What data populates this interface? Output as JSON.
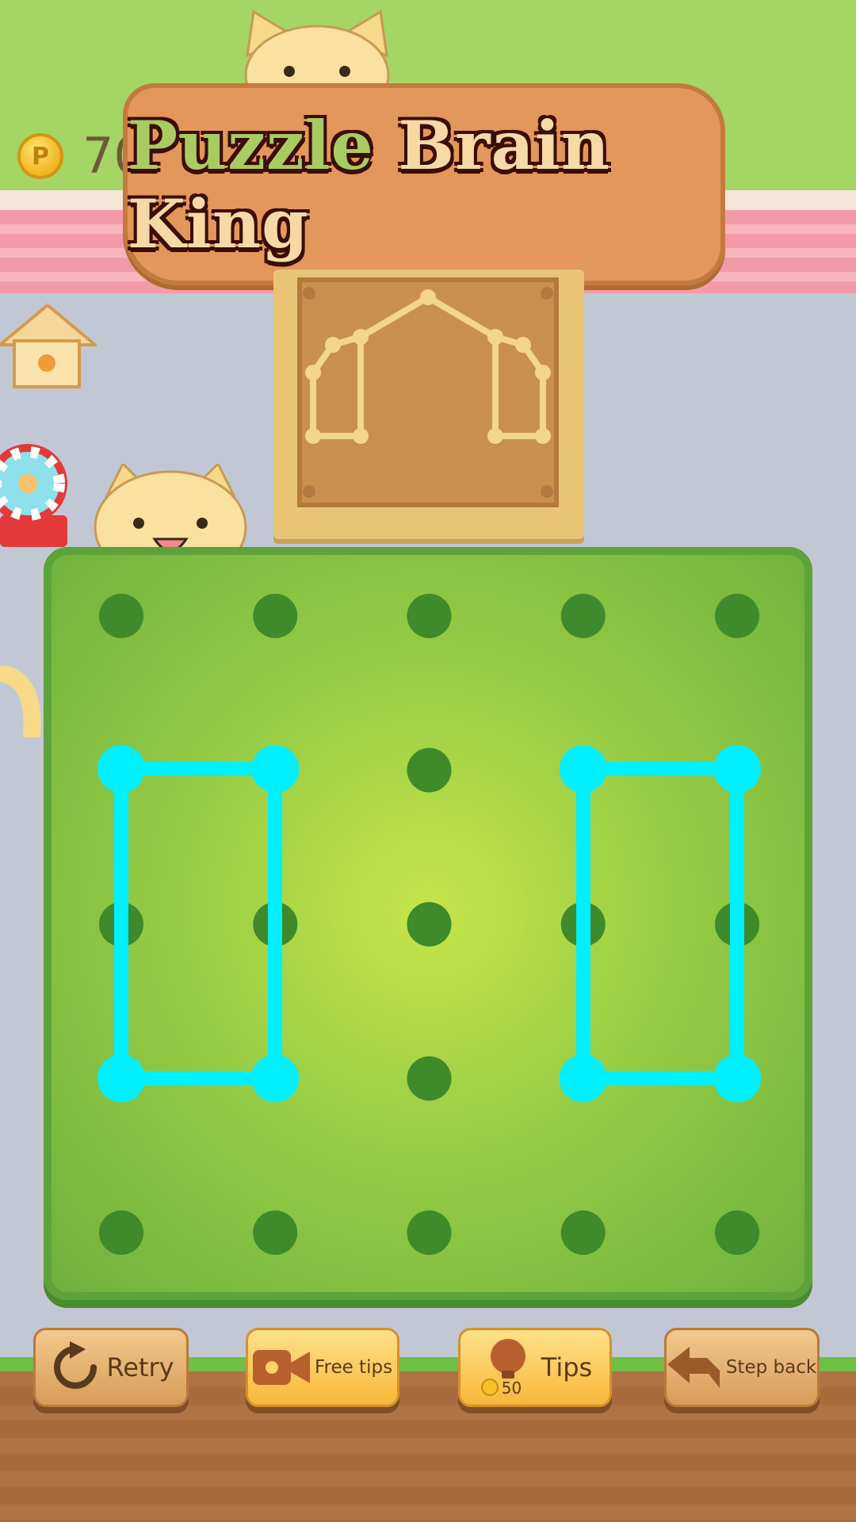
{
  "header": {
    "coin_count": "70",
    "coin_symbol": "P"
  },
  "title": {
    "part1": "Puzzle",
    "part2": "Brain King"
  },
  "board": {
    "dot_color": "#3f8a2a",
    "line_color": "#00f0ff",
    "grid_columns": 5,
    "grid_rows": 5
  },
  "buttons": {
    "retry": "Retry",
    "free_tips": "Free tips",
    "tips": "Tips",
    "tips_cost": "50",
    "step_back": "Step back"
  }
}
